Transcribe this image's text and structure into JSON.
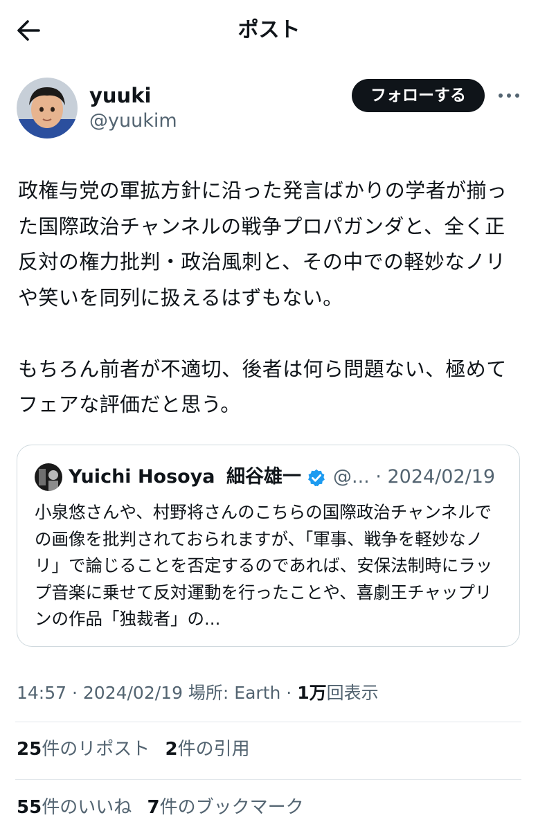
{
  "header": {
    "title": "ポスト",
    "back_icon": "arrow-left-icon"
  },
  "author": {
    "name": "yuuki",
    "handle": "@yuukim",
    "follow_label": "フォローする",
    "more_icon": "more-dots-icon"
  },
  "post": {
    "paragraphs": [
      "政権与党の軍拡方針に沿った発言ばかりの学者が揃った国際政治チャンネルの戦争プロパガンダと、全く正反対の権力批判・政治風刺と、その中での軽妙なノリや笑いを同列に扱えるはずもない。",
      "もちろん前者が不適切、後者は何ら問題ない、極めてフェアな評価だと思う。"
    ]
  },
  "quote": {
    "name": "Yuichi Hosoya",
    "name_ja": "細谷雄一",
    "verified_icon": "verified-badge-icon",
    "handle_date": "@... · 2024/02/19",
    "text": "小泉悠さんや、村野将さんのこちらの国際政治チャンネルでの画像を批判されておられますが、「軍事、戦争を軽妙なノリ」で論じることを否定するのであれば、安保法制時にラップ音楽に乗せて反対運動を行ったことや、喜劇王チャップリンの作品「独裁者」の..."
  },
  "meta": {
    "time": "14:57 · 2024/02/19 場所: Earth · ",
    "views_count": "1万",
    "views_label": "回表示"
  },
  "stats": {
    "reposts_count": "25",
    "reposts_label": "件のリポスト",
    "quotes_count": "2",
    "quotes_label": "件の引用",
    "likes_count": "55",
    "likes_label": "件のいいね",
    "bookmarks_count": "7",
    "bookmarks_label": "件のブックマーク"
  },
  "colors": {
    "text": "#0f1419",
    "secondary": "#536471",
    "border": "#cfd9de",
    "verified": "#1d9bf0",
    "button": "#0f1419"
  }
}
